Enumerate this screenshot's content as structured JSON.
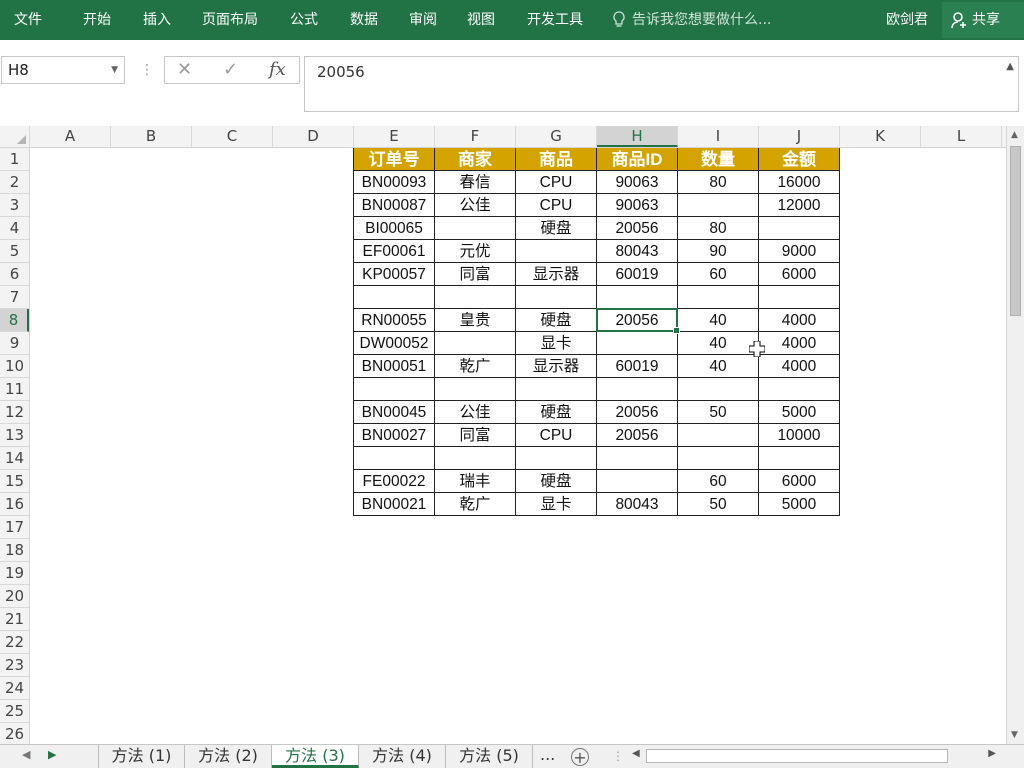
{
  "ribbon": {
    "tabs": [
      "文件",
      "开始",
      "插入",
      "页面布局",
      "公式",
      "数据",
      "审阅",
      "视图",
      "开发工具"
    ],
    "tell_me": "告诉我您想要做什么...",
    "user": "欧剑君",
    "share": "共享",
    "bg_color": "#217346"
  },
  "formula_bar": {
    "name_box": "H8",
    "cancel_icon": "✕",
    "enter_icon": "✓",
    "fx_label": "fx",
    "formula": "20056"
  },
  "columns": [
    "A",
    "B",
    "C",
    "D",
    "E",
    "F",
    "G",
    "H",
    "I",
    "J",
    "K",
    "L"
  ],
  "rows": [
    "1",
    "2",
    "3",
    "4",
    "5",
    "6",
    "7",
    "8",
    "9",
    "10",
    "11",
    "12",
    "13",
    "14",
    "15",
    "16",
    "17",
    "18",
    "19",
    "20",
    "21",
    "22",
    "23",
    "24",
    "25",
    "26"
  ],
  "selected": {
    "column": "H",
    "row": "8"
  },
  "table": {
    "header_color": "#d4a300",
    "headers": [
      "订单号",
      "商家",
      "商品",
      "商品ID",
      "数量",
      "金额"
    ],
    "rows": [
      [
        "BN00093",
        "春信",
        "CPU",
        "90063",
        "80",
        "16000"
      ],
      [
        "BN00087",
        "公佳",
        "CPU",
        "90063",
        "",
        "12000"
      ],
      [
        "BI00065",
        "",
        "硬盘",
        "20056",
        "80",
        ""
      ],
      [
        "EF00061",
        "元优",
        "",
        "80043",
        "90",
        "9000"
      ],
      [
        "KP00057",
        "同富",
        "显示器",
        "60019",
        "60",
        "6000"
      ],
      [
        "",
        "",
        "",
        "",
        "",
        ""
      ],
      [
        "RN00055",
        "皇贵",
        "硬盘",
        "20056",
        "40",
        "4000"
      ],
      [
        "DW00052",
        "",
        "显卡",
        "",
        "40",
        "4000"
      ],
      [
        "BN00051",
        "乾广",
        "显示器",
        "60019",
        "40",
        "4000"
      ],
      [
        "",
        "",
        "",
        "",
        "",
        ""
      ],
      [
        "BN00045",
        "公佳",
        "硬盘",
        "20056",
        "50",
        "5000"
      ],
      [
        "BN00027",
        "同富",
        "CPU",
        "20056",
        "",
        "10000"
      ],
      [
        "",
        "",
        "",
        "",
        "",
        ""
      ],
      [
        "FE00022",
        "瑞丰",
        "硬盘",
        "",
        "60",
        "6000"
      ],
      [
        "BN00021",
        "乾广",
        "显卡",
        "80043",
        "50",
        "5000"
      ]
    ]
  },
  "sheet_tabs": {
    "tabs": [
      "方法 (1)",
      "方法 (2)",
      "方法 (3)",
      "方法 (4)",
      "方法 (5)"
    ],
    "active": "方法 (3)",
    "more": "...",
    "add": "+"
  }
}
